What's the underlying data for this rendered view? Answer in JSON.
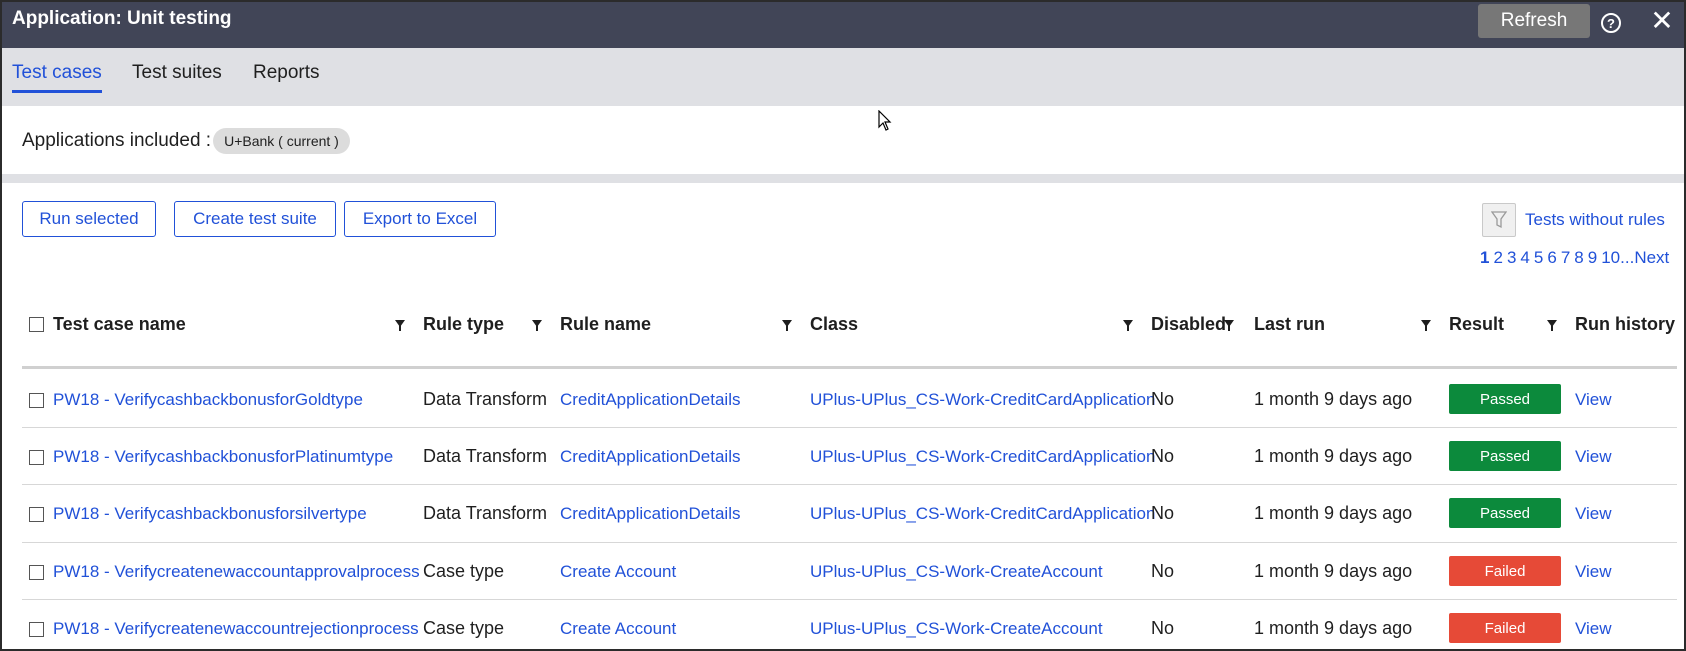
{
  "titlebar": {
    "title": "Application: Unit testing",
    "refresh_label": "Refresh",
    "help_icon": "?",
    "close_icon": "✕"
  },
  "tabs": [
    {
      "label": "Test cases",
      "active": true
    },
    {
      "label": "Test suites",
      "active": false
    },
    {
      "label": "Reports",
      "active": false
    }
  ],
  "applications": {
    "label": "Applications included :",
    "pill": "U+Bank ( current )"
  },
  "actions": {
    "run_selected": "Run selected",
    "create_test_suite": "Create test suite",
    "export_excel": "Export to Excel",
    "tests_without_rules": "Tests without rules"
  },
  "pager": {
    "current": "1",
    "pages": [
      "2",
      "3",
      "4",
      "5",
      "6",
      "7",
      "8",
      "9",
      "10..."
    ],
    "next": "Next"
  },
  "table": {
    "headers": {
      "test_case_name": "Test case name",
      "rule_type": "Rule type",
      "rule_name": "Rule name",
      "class": "Class",
      "disabled": "Disabled",
      "last_run": "Last run",
      "result": "Result",
      "run_history": "Run history"
    },
    "rows": [
      {
        "name": "PW18 - VerifycashbackbonusforGoldtype",
        "rule_type": "Data Transform",
        "rule_name": "CreditApplicationDetails",
        "class": "UPlus-UPlus_CS-Work-CreditCardApplication",
        "disabled": "No",
        "last_run": "1 month 9 days ago",
        "result": "Passed",
        "history": "View"
      },
      {
        "name": "PW18 - VerifycashbackbonusforPlatinumtype",
        "rule_type": "Data Transform",
        "rule_name": "CreditApplicationDetails",
        "class": "UPlus-UPlus_CS-Work-CreditCardApplication",
        "disabled": "No",
        "last_run": "1 month 9 days ago",
        "result": "Passed",
        "history": "View"
      },
      {
        "name": "PW18 - Verifycashbackbonusforsilvertype",
        "rule_type": "Data Transform",
        "rule_name": "CreditApplicationDetails",
        "class": "UPlus-UPlus_CS-Work-CreditCardApplication",
        "disabled": "No",
        "last_run": "1 month 9 days ago",
        "result": "Passed",
        "history": "View"
      },
      {
        "name": "PW18 - Verifycreatenewaccountapprovalprocess",
        "rule_type": "Case type",
        "rule_name": "Create Account",
        "class": "UPlus-UPlus_CS-Work-CreateAccount",
        "disabled": "No",
        "last_run": "1 month 9 days ago",
        "result": "Failed",
        "history": "View"
      },
      {
        "name": "PW18 - Verifycreatenewaccountrejectionprocess",
        "rule_type": "Case type",
        "rule_name": "Create Account",
        "class": "UPlus-UPlus_CS-Work-CreateAccount",
        "disabled": "No",
        "last_run": "1 month 9 days ago",
        "result": "Failed",
        "history": "View"
      }
    ]
  },
  "colors": {
    "titlebar": "#414557",
    "accent": "#2151d8",
    "passed": "#0c8a3c",
    "failed": "#e64a37"
  }
}
